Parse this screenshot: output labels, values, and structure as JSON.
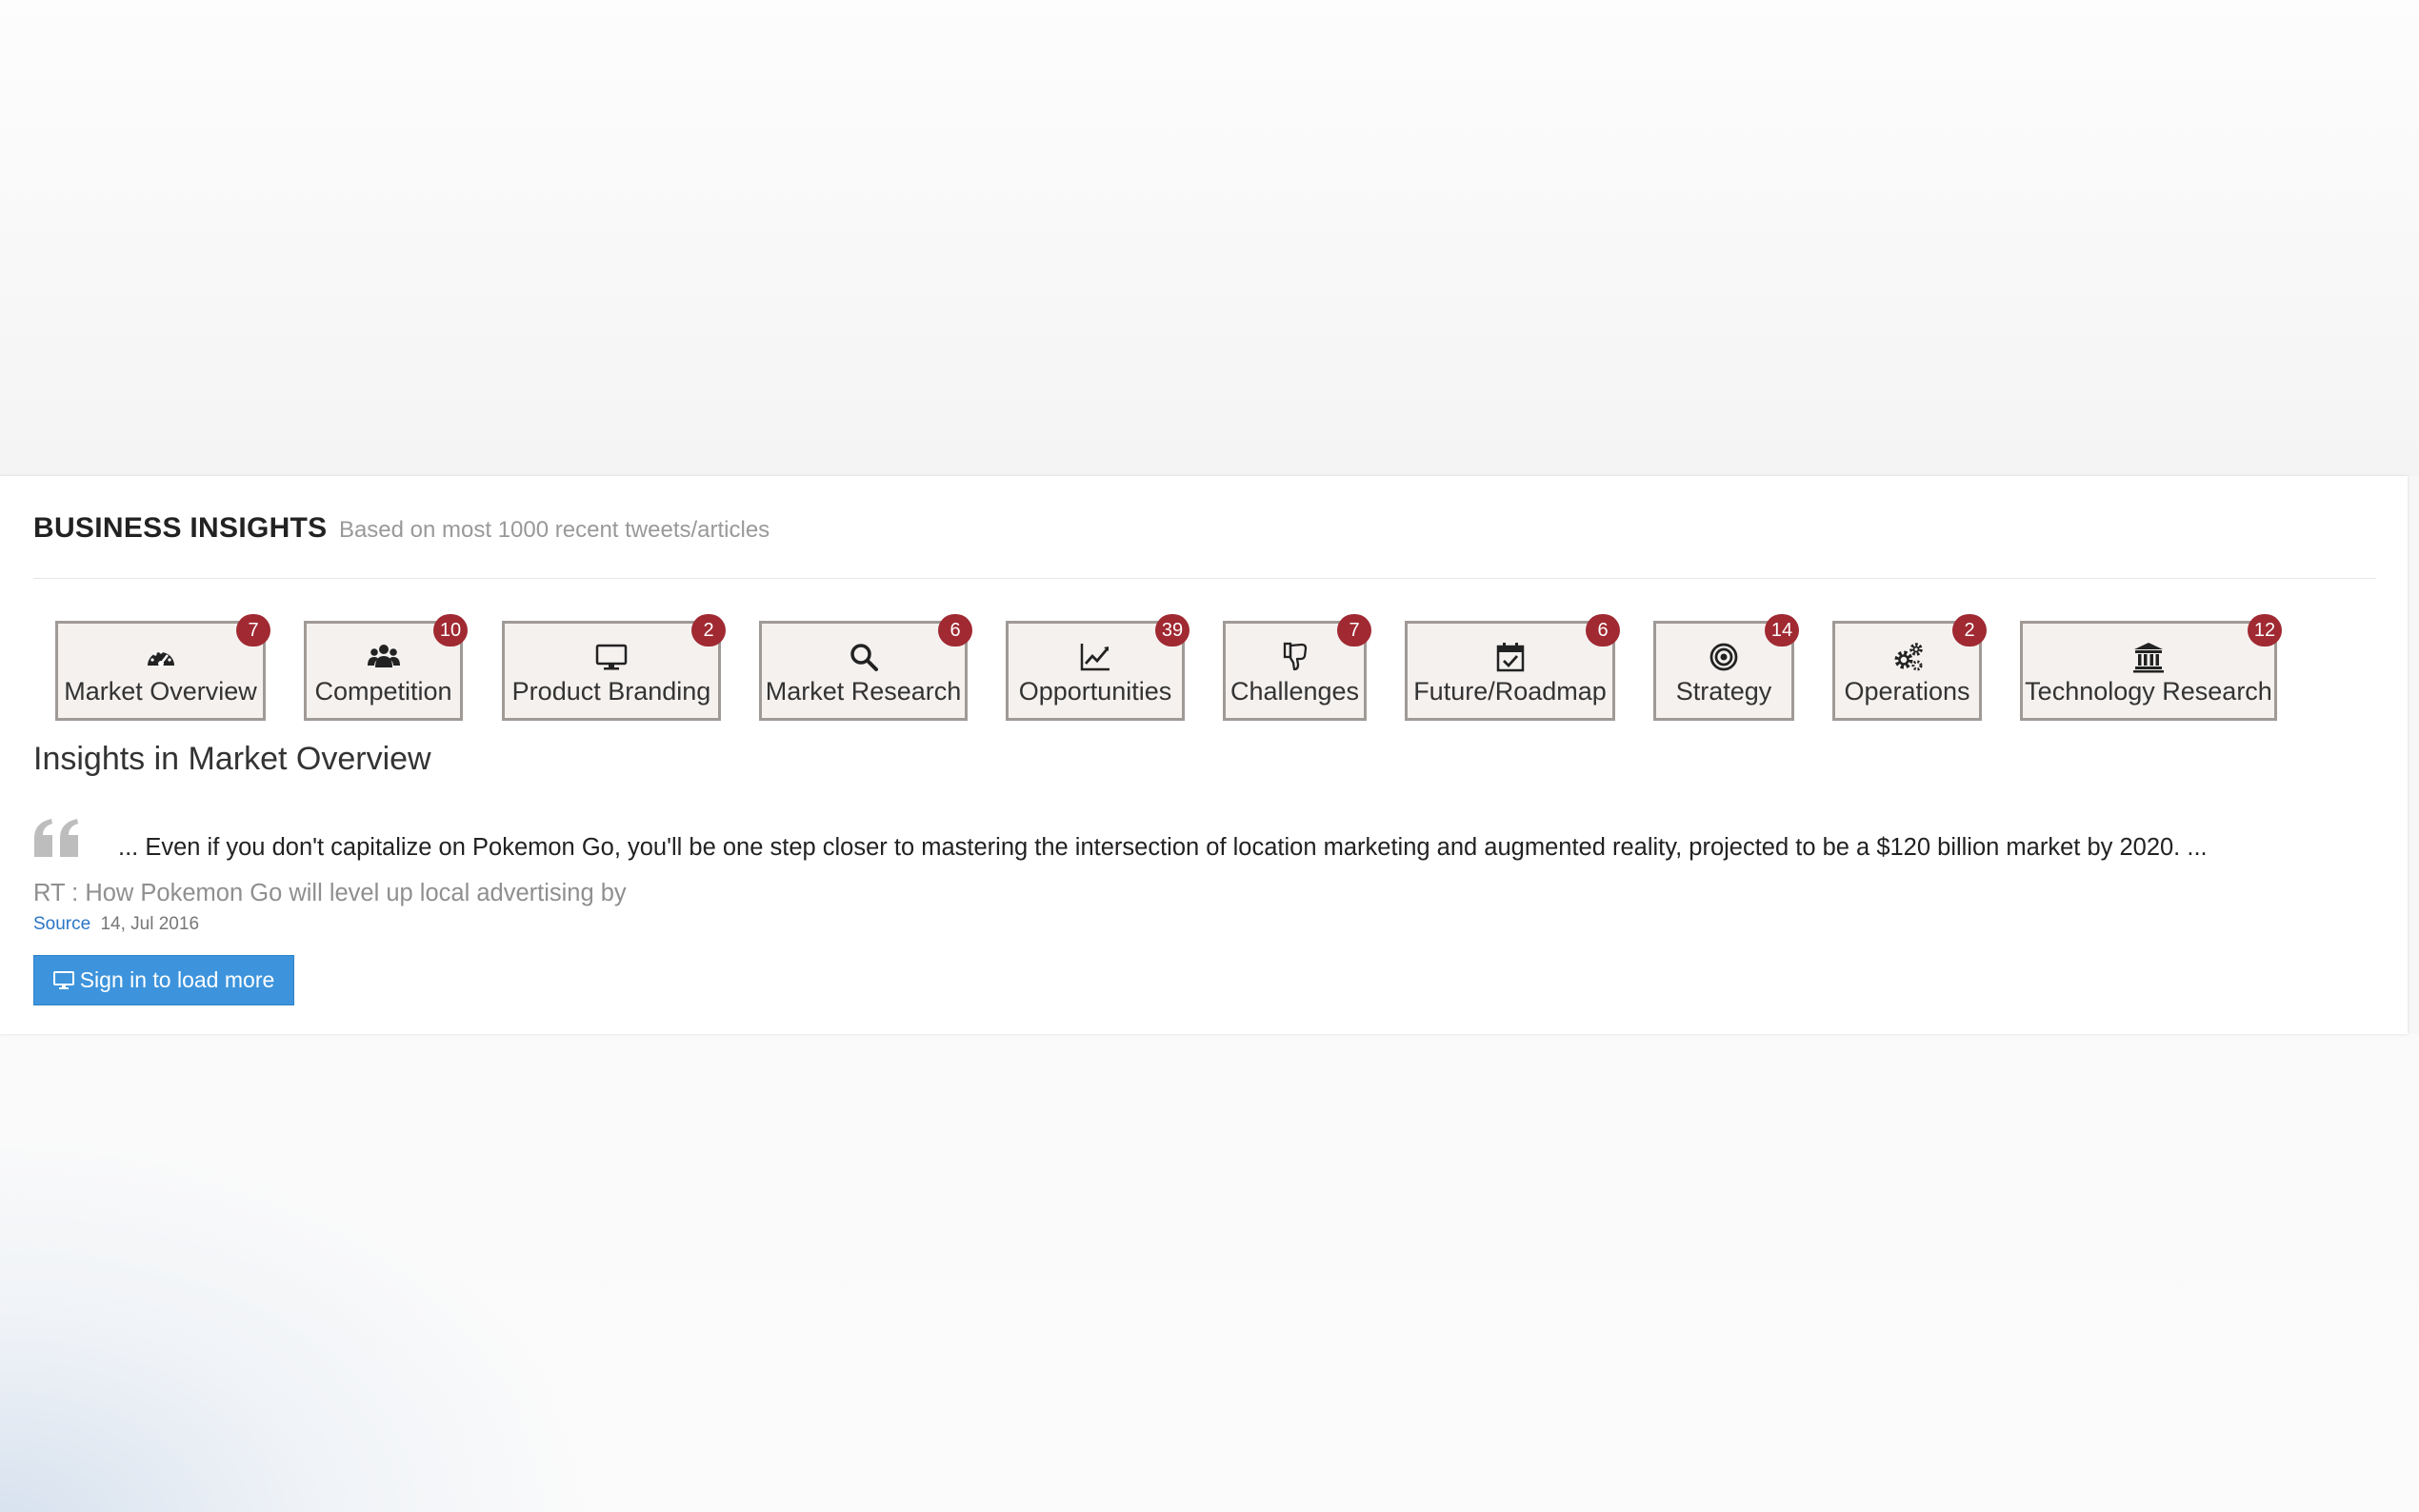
{
  "header": {
    "title": "BUSINESS INSIGHTS",
    "subtitle": "Based on most 1000 recent tweets/articles"
  },
  "categories": [
    {
      "label": "Market Overview",
      "count": "7",
      "icon": "dashboard-icon"
    },
    {
      "label": "Competition",
      "count": "10",
      "icon": "users-icon"
    },
    {
      "label": "Product Branding",
      "count": "2",
      "icon": "desktop-icon"
    },
    {
      "label": "Market Research",
      "count": "6",
      "icon": "search-icon"
    },
    {
      "label": "Opportunities",
      "count": "39",
      "icon": "line-chart-icon"
    },
    {
      "label": "Challenges",
      "count": "7",
      "icon": "thumbs-down-icon"
    },
    {
      "label": "Future/Roadmap",
      "count": "6",
      "icon": "calendar-check-icon"
    },
    {
      "label": "Strategy",
      "count": "14",
      "icon": "bullseye-icon"
    },
    {
      "label": "Operations",
      "count": "2",
      "icon": "cogs-icon"
    },
    {
      "label": "Technology Research",
      "count": "12",
      "icon": "institution-icon"
    }
  ],
  "section": {
    "title": "Insights in Market Overview"
  },
  "insight": {
    "quote": "... Even if you don't capitalize on Pokemon Go, you'll be one step closer to mastering the intersection of location marketing and augmented reality, projected to be a $120 billion market by 2020. ...",
    "rt": "RT : How Pokemon Go will level up local advertising by",
    "source_label": "Source",
    "date": "14, Jul 2016"
  },
  "signin": {
    "label": "Sign in to load more",
    "icon": "desktop-icon"
  },
  "colors": {
    "badge": "#a02932",
    "button": "#3d94dc",
    "link": "#2a76c6",
    "tile_bg": "#f4f1ef",
    "tile_border": "#a09a96"
  }
}
